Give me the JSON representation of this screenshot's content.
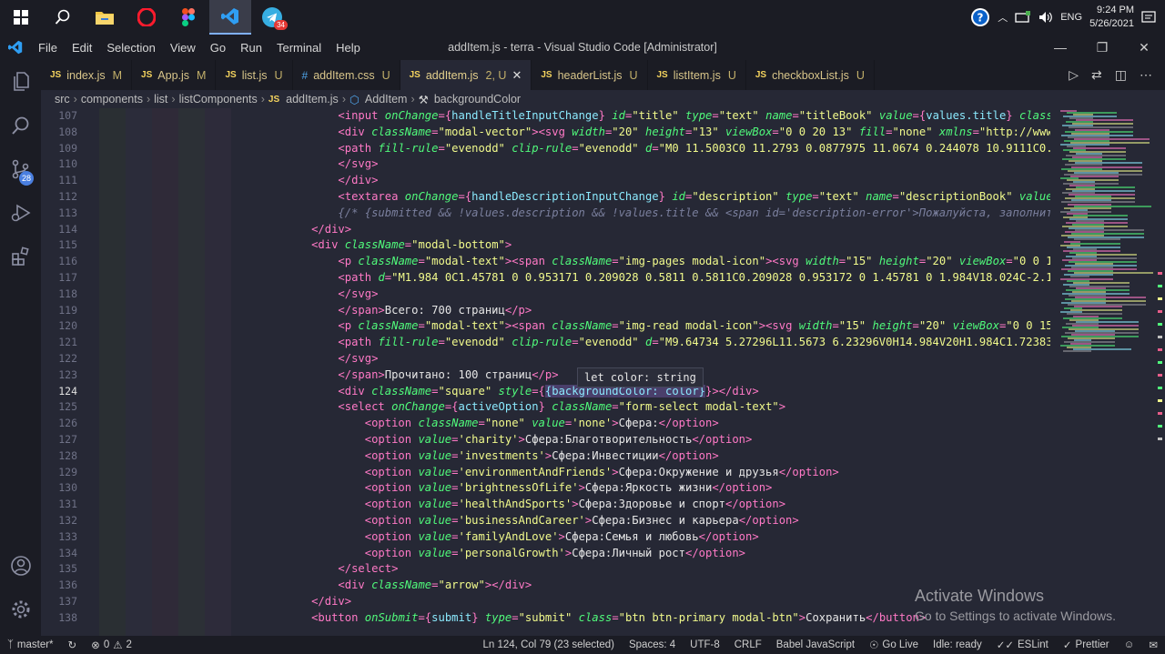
{
  "taskbar": {
    "clock_time": "9:24 PM",
    "clock_date": "5/26/2021",
    "language": "ENG",
    "telegram_badge": "34",
    "apps": [
      "windows-start",
      "search",
      "file-explorer",
      "opera",
      "figma",
      "vscode",
      "telegram"
    ]
  },
  "window": {
    "title": "addItem.js - terra - Visual Studio Code [Administrator]",
    "menu": [
      "File",
      "Edit",
      "Selection",
      "View",
      "Go",
      "Run",
      "Terminal",
      "Help"
    ]
  },
  "activity": {
    "scm_badge": "28"
  },
  "tabs": [
    {
      "type": "JS",
      "label": "index.js",
      "status": "M",
      "active": false
    },
    {
      "type": "JS",
      "label": "App.js",
      "status": "M",
      "active": false
    },
    {
      "type": "JS",
      "label": "list.js",
      "status": "U",
      "active": false
    },
    {
      "type": "#",
      "label": "addItem.css",
      "status": "U",
      "active": false
    },
    {
      "type": "JS",
      "label": "addItem.js",
      "status": "2, U",
      "active": true
    },
    {
      "type": "JS",
      "label": "headerList.js",
      "status": "U",
      "active": false
    },
    {
      "type": "JS",
      "label": "listItem.js",
      "status": "U",
      "active": false
    },
    {
      "type": "JS",
      "label": "checkboxList.js",
      "status": "U",
      "active": false
    }
  ],
  "breadcrumbs": [
    "src",
    "components",
    "list",
    "listComponents",
    "addItem.js",
    "AddItem",
    "backgroundColor"
  ],
  "editor": {
    "current_line": 124,
    "hover_text": "let color: string",
    "line_numbers": [
      "107",
      "108",
      "109",
      "110",
      "111",
      "112",
      "113",
      "114",
      "115",
      "116",
      "117",
      "118",
      "119",
      "120",
      "121",
      "122",
      "123",
      "124",
      "125",
      "126",
      "127",
      "128",
      "129",
      "130",
      "131",
      "132",
      "133",
      "134",
      "135",
      "136",
      "137",
      "138"
    ],
    "lines": [
      [
        [
          "                ",
          ""
        ],
        [
          "<input ",
          "t"
        ],
        [
          "onChange",
          "a"
        ],
        [
          "={",
          "t"
        ],
        [
          "handleTitleInputChange",
          "p"
        ],
        [
          "} ",
          "t"
        ],
        [
          "id",
          "a"
        ],
        [
          "=",
          "t"
        ],
        [
          "\"title\"",
          "s"
        ],
        [
          " type",
          "a"
        ],
        [
          "=",
          "t"
        ],
        [
          "\"text\"",
          "s"
        ],
        [
          " name",
          "a"
        ],
        [
          "=",
          "t"
        ],
        [
          "\"titleBook\"",
          "s"
        ],
        [
          " value",
          "a"
        ],
        [
          "={",
          "t"
        ],
        [
          "values.title",
          "p"
        ],
        [
          "} ",
          "t"
        ],
        [
          "className",
          "a"
        ],
        [
          "=",
          "t"
        ],
        [
          "\"modal-in",
          "s"
        ]
      ],
      [
        [
          "                ",
          ""
        ],
        [
          "<div ",
          "t"
        ],
        [
          "className",
          "a"
        ],
        [
          "=",
          "t"
        ],
        [
          "\"modal-vector\"",
          "s"
        ],
        [
          ">",
          "t"
        ],
        [
          "<svg ",
          "t"
        ],
        [
          "width",
          "a"
        ],
        [
          "=",
          "t"
        ],
        [
          "\"20\"",
          "s"
        ],
        [
          " height",
          "a"
        ],
        [
          "=",
          "t"
        ],
        [
          "\"13\"",
          "s"
        ],
        [
          " viewBox",
          "a"
        ],
        [
          "=",
          "t"
        ],
        [
          "\"0 0 20 13\"",
          "s"
        ],
        [
          " fill",
          "a"
        ],
        [
          "=",
          "t"
        ],
        [
          "\"none\"",
          "s"
        ],
        [
          " xmlns",
          "a"
        ],
        [
          "=",
          "t"
        ],
        [
          "\"http://www.w3.org/2000/s",
          "s"
        ]
      ],
      [
        [
          "                ",
          ""
        ],
        [
          "<path ",
          "t"
        ],
        [
          "fill-rule",
          "a"
        ],
        [
          "=",
          "t"
        ],
        [
          "\"evenodd\"",
          "s"
        ],
        [
          " clip-rule",
          "a"
        ],
        [
          "=",
          "t"
        ],
        [
          "\"evenodd\"",
          "s"
        ],
        [
          " d",
          "a"
        ],
        [
          "=",
          "t"
        ],
        [
          "\"M0 11.5003C0 11.2793 0.0877975 11.0674 0.244078 10.9111C0.400358 10.7548",
          "s"
        ]
      ],
      [
        [
          "                ",
          ""
        ],
        [
          "</svg>",
          "t"
        ]
      ],
      [
        [
          "                ",
          ""
        ],
        [
          "</div>",
          "t"
        ]
      ],
      [
        [
          "                ",
          ""
        ],
        [
          "<textarea ",
          "t"
        ],
        [
          "onChange",
          "a"
        ],
        [
          "={",
          "t"
        ],
        [
          "handleDescriptionInputChange",
          "p"
        ],
        [
          "} ",
          "t"
        ],
        [
          "id",
          "a"
        ],
        [
          "=",
          "t"
        ],
        [
          "\"description\"",
          "s"
        ],
        [
          " type",
          "a"
        ],
        [
          "=",
          "t"
        ],
        [
          "\"text\"",
          "s"
        ],
        [
          " name",
          "a"
        ],
        [
          "=",
          "t"
        ],
        [
          "\"descriptionBook\"",
          "s"
        ],
        [
          " value",
          "a"
        ],
        [
          "={",
          "t"
        ],
        [
          "values.descr",
          "p"
        ]
      ],
      [
        [
          "                ",
          ""
        ],
        [
          "{/* {submitted && !values.description && !values.title && <span id='description-error'>Пожалуйста, заполните все поля</sp",
          "c"
        ]
      ],
      [
        [
          "            ",
          ""
        ],
        [
          "</div>",
          "t"
        ]
      ],
      [
        [
          "            ",
          ""
        ],
        [
          "<div ",
          "t"
        ],
        [
          "className",
          "a"
        ],
        [
          "=",
          "t"
        ],
        [
          "\"modal-bottom\"",
          "s"
        ],
        [
          ">",
          "t"
        ]
      ],
      [
        [
          "                ",
          ""
        ],
        [
          "<p ",
          "t"
        ],
        [
          "className",
          "a"
        ],
        [
          "=",
          "t"
        ],
        [
          "\"modal-text\"",
          "s"
        ],
        [
          ">",
          "t"
        ],
        [
          "<span ",
          "t"
        ],
        [
          "className",
          "a"
        ],
        [
          "=",
          "t"
        ],
        [
          "\"img-pages modal-icon\"",
          "s"
        ],
        [
          ">",
          "t"
        ],
        [
          "<svg ",
          "t"
        ],
        [
          "width",
          "a"
        ],
        [
          "=",
          "t"
        ],
        [
          "\"15\"",
          "s"
        ],
        [
          " height",
          "a"
        ],
        [
          "=",
          "t"
        ],
        [
          "\"20\"",
          "s"
        ],
        [
          " viewBox",
          "a"
        ],
        [
          "=",
          "t"
        ],
        [
          "\"0 0 15 20\"",
          "s"
        ],
        [
          " fill",
          "a"
        ],
        [
          "=",
          "t"
        ],
        [
          "\"no",
          "s"
        ]
      ],
      [
        [
          "                ",
          ""
        ],
        [
          "<path ",
          "t"
        ],
        [
          "d",
          "a"
        ],
        [
          "=",
          "t"
        ],
        [
          "\"M1.984 0C1.45781 0 0.953171 0.209028 0.5811 0.5811C0.209028 0.953172 0 1.45781 0 1.984V18.024C-2.13214e-06 18.28",
          "s"
        ]
      ],
      [
        [
          "                ",
          ""
        ],
        [
          "</svg>",
          "t"
        ]
      ],
      [
        [
          "                ",
          ""
        ],
        [
          "</span>",
          "t"
        ],
        [
          "Всего: 700 страниц",
          "tx"
        ],
        [
          "</p>",
          "t"
        ]
      ],
      [
        [
          "                ",
          ""
        ],
        [
          "<p ",
          "t"
        ],
        [
          "className",
          "a"
        ],
        [
          "=",
          "t"
        ],
        [
          "\"modal-text\"",
          "s"
        ],
        [
          ">",
          "t"
        ],
        [
          "<span ",
          "t"
        ],
        [
          "className",
          "a"
        ],
        [
          "=",
          "t"
        ],
        [
          "\"img-read modal-icon\"",
          "s"
        ],
        [
          ">",
          "t"
        ],
        [
          "<svg ",
          "t"
        ],
        [
          "width",
          "a"
        ],
        [
          "=",
          "t"
        ],
        [
          "\"15\"",
          "s"
        ],
        [
          " height",
          "a"
        ],
        [
          "=",
          "t"
        ],
        [
          "\"20\"",
          "s"
        ],
        [
          " viewBox",
          "a"
        ],
        [
          "=",
          "t"
        ],
        [
          "\"0 0 15 20\"",
          "s"
        ],
        [
          " fill",
          "a"
        ],
        [
          "=",
          "t"
        ],
        [
          "\"non",
          "s"
        ]
      ],
      [
        [
          "                ",
          ""
        ],
        [
          "<path ",
          "t"
        ],
        [
          "fill-rule",
          "a"
        ],
        [
          "=",
          "t"
        ],
        [
          "\"evenodd\"",
          "s"
        ],
        [
          " clip-rule",
          "a"
        ],
        [
          "=",
          "t"
        ],
        [
          "\"evenodd\"",
          "s"
        ],
        [
          " d",
          "a"
        ],
        [
          "=",
          "t"
        ],
        [
          "\"M9.64734 5.27296L11.5673 6.23296V0H14.984V20H1.984C1.72383 20.001 1.4660",
          "s"
        ]
      ],
      [
        [
          "                ",
          ""
        ],
        [
          "</svg>",
          "t"
        ]
      ],
      [
        [
          "                ",
          ""
        ],
        [
          "</span>",
          "t"
        ],
        [
          "Прочитано: 100 страниц",
          "tx"
        ],
        [
          "</p>",
          "t"
        ]
      ],
      [
        [
          "                ",
          ""
        ],
        [
          "<div ",
          "t"
        ],
        [
          "className",
          "a"
        ],
        [
          "=",
          "t"
        ],
        [
          "\"square\"",
          "s"
        ],
        [
          " style",
          "a"
        ],
        [
          "={",
          "t"
        ],
        [
          "{backgroundColor: color}",
          "p"
        ],
        [
          "}>",
          "t"
        ],
        [
          "</div>",
          "t"
        ]
      ],
      [
        [
          "                ",
          ""
        ],
        [
          "<select ",
          "t"
        ],
        [
          "onChange",
          "a"
        ],
        [
          "={",
          "t"
        ],
        [
          "activeOption",
          "p"
        ],
        [
          "} ",
          "t"
        ],
        [
          "className",
          "a"
        ],
        [
          "=",
          "t"
        ],
        [
          "\"form-select modal-text\"",
          "s"
        ],
        [
          ">",
          "t"
        ]
      ],
      [
        [
          "                    ",
          ""
        ],
        [
          "<option ",
          "t"
        ],
        [
          "className",
          "a"
        ],
        [
          "=",
          "t"
        ],
        [
          "\"none\"",
          "s"
        ],
        [
          " value",
          "a"
        ],
        [
          "=",
          "t"
        ],
        [
          "'none'",
          "s"
        ],
        [
          ">",
          "t"
        ],
        [
          "Сфера:",
          "tx"
        ],
        [
          "</option>",
          "t"
        ]
      ],
      [
        [
          "                    ",
          ""
        ],
        [
          "<option ",
          "t"
        ],
        [
          "value",
          "a"
        ],
        [
          "=",
          "t"
        ],
        [
          "'charity'",
          "s"
        ],
        [
          ">",
          "t"
        ],
        [
          "Сфера:Благотворительность",
          "tx"
        ],
        [
          "</option>",
          "t"
        ]
      ],
      [
        [
          "                    ",
          ""
        ],
        [
          "<option ",
          "t"
        ],
        [
          "value",
          "a"
        ],
        [
          "=",
          "t"
        ],
        [
          "'investments'",
          "s"
        ],
        [
          ">",
          "t"
        ],
        [
          "Сфера:Инвестиции",
          "tx"
        ],
        [
          "</option>",
          "t"
        ]
      ],
      [
        [
          "                    ",
          ""
        ],
        [
          "<option ",
          "t"
        ],
        [
          "value",
          "a"
        ],
        [
          "=",
          "t"
        ],
        [
          "'environmentAndFriends'",
          "s"
        ],
        [
          ">",
          "t"
        ],
        [
          "Сфера:Окружение и друзья",
          "tx"
        ],
        [
          "</option>",
          "t"
        ]
      ],
      [
        [
          "                    ",
          ""
        ],
        [
          "<option ",
          "t"
        ],
        [
          "value",
          "a"
        ],
        [
          "=",
          "t"
        ],
        [
          "'brightnessOfLife'",
          "s"
        ],
        [
          ">",
          "t"
        ],
        [
          "Сфера:Яркость жизни",
          "tx"
        ],
        [
          "</option>",
          "t"
        ]
      ],
      [
        [
          "                    ",
          ""
        ],
        [
          "<option ",
          "t"
        ],
        [
          "value",
          "a"
        ],
        [
          "=",
          "t"
        ],
        [
          "'healthAndSports'",
          "s"
        ],
        [
          ">",
          "t"
        ],
        [
          "Сфера:Здоровье и спорт",
          "tx"
        ],
        [
          "</option>",
          "t"
        ]
      ],
      [
        [
          "                    ",
          ""
        ],
        [
          "<option ",
          "t"
        ],
        [
          "value",
          "a"
        ],
        [
          "=",
          "t"
        ],
        [
          "'businessAndCareer'",
          "s"
        ],
        [
          ">",
          "t"
        ],
        [
          "Сфера:Бизнес и карьера",
          "tx"
        ],
        [
          "</option>",
          "t"
        ]
      ],
      [
        [
          "                    ",
          ""
        ],
        [
          "<option ",
          "t"
        ],
        [
          "value",
          "a"
        ],
        [
          "=",
          "t"
        ],
        [
          "'familyAndLove'",
          "s"
        ],
        [
          ">",
          "t"
        ],
        [
          "Сфера:Семья и любовь",
          "tx"
        ],
        [
          "</option>",
          "t"
        ]
      ],
      [
        [
          "                    ",
          ""
        ],
        [
          "<option ",
          "t"
        ],
        [
          "value",
          "a"
        ],
        [
          "=",
          "t"
        ],
        [
          "'personalGrowth'",
          "s"
        ],
        [
          ">",
          "t"
        ],
        [
          "Сфера:Личный рост",
          "tx"
        ],
        [
          "</option>",
          "t"
        ]
      ],
      [
        [
          "                ",
          ""
        ],
        [
          "</select>",
          "t"
        ]
      ],
      [
        [
          "                ",
          ""
        ],
        [
          "<div ",
          "t"
        ],
        [
          "className",
          "a"
        ],
        [
          "=",
          "t"
        ],
        [
          "\"arrow\"",
          "s"
        ],
        [
          ">",
          "t"
        ],
        [
          "</div>",
          "t"
        ]
      ],
      [
        [
          "            ",
          ""
        ],
        [
          "</div>",
          "t"
        ]
      ],
      [
        [
          "            ",
          ""
        ],
        [
          "<button ",
          "t"
        ],
        [
          "onSubmit",
          "a"
        ],
        [
          "={",
          "t"
        ],
        [
          "submit",
          "p"
        ],
        [
          "} ",
          "t"
        ],
        [
          "type",
          "a"
        ],
        [
          "=",
          "t"
        ],
        [
          "\"submit\"",
          "s"
        ],
        [
          " class",
          "a"
        ],
        [
          "=",
          "t"
        ],
        [
          "\"btn btn-primary modal-btn\"",
          "s"
        ],
        [
          ">",
          "t"
        ],
        [
          "Сохранить",
          "tx"
        ],
        [
          "</button>",
          "t"
        ]
      ]
    ]
  },
  "watermark": {
    "title": "Activate Windows",
    "subtitle": "Go to Settings to activate Windows."
  },
  "statusbar": {
    "branch": "master*",
    "errors": "0",
    "warnings": "2",
    "cursor": "Ln 124, Col 79 (23 selected)",
    "spaces": "Spaces: 4",
    "encoding": "UTF-8",
    "eol": "CRLF",
    "language": "Babel JavaScript",
    "go_live": "Go Live",
    "idle": "Idle: ready",
    "eslint": "ESLint",
    "prettier": "Prettier"
  },
  "colors": {
    "attr": "#50fa7b",
    "tag": "#ff79c6",
    "string": "#f1fa8c",
    "expr": "#8be9fd",
    "comment": "#7a7f9d",
    "bg": "#262835",
    "chrome": "#1b1c24"
  }
}
